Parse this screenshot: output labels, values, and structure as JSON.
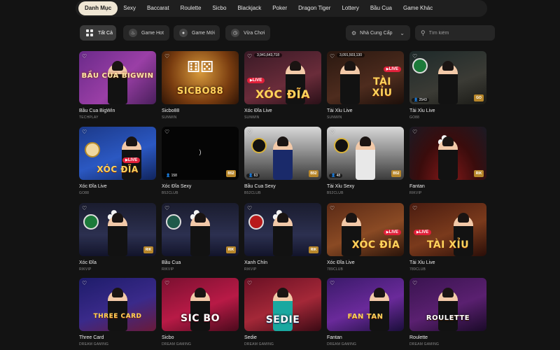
{
  "categories": {
    "active": "Danh Mục",
    "items": [
      "Sexy",
      "Baccarat",
      "Roulette",
      "Sicbo",
      "Blackjack",
      "Poker",
      "Dragon Tiger",
      "Lottery",
      "Bầu Cua",
      "Game Khác"
    ]
  },
  "filters": {
    "all": "Tất Cả",
    "hot": "Game Hot",
    "new": "Game Mới",
    "recent": "Vừa Chơi",
    "provider_label": "Nhà Cung Cấp",
    "search_placeholder": "Tìm kiếm"
  },
  "games": [
    {
      "title": "Bầu Cua BigWin",
      "provider": "TECHPLAY",
      "logo": "BẦU CUA BIGWIN"
    },
    {
      "title": "Sicbo88",
      "provider": "SUNWIN",
      "logo": "SICBO88"
    },
    {
      "title": "Xóc Đĩa Live",
      "provider": "SUNWIN",
      "logo": "XÓC ĐĨA",
      "live": "LIVE",
      "amount": "3,941,643,718"
    },
    {
      "title": "Tài Xỉu Live",
      "provider": "SUNWIN",
      "logo": "TÀI XỈU",
      "live": "LIVE",
      "amount": "3,091,503,130"
    },
    {
      "title": "Tài Xỉu Live",
      "provider": "GO88",
      "players": "2543"
    },
    {
      "title": "Xóc Đĩa Live",
      "provider": "GO88",
      "logo": "XÓC ĐĨA",
      "live": "LIVE"
    },
    {
      "title": "Xóc Đĩa Sexy",
      "provider": "B52CLUB",
      "players": "158",
      "center": ")"
    },
    {
      "title": "Bầu Cua Sexy",
      "provider": "B52CLUB",
      "players": "63"
    },
    {
      "title": "Tài Xỉu Sexy",
      "provider": "B52CLUB",
      "players": "48"
    },
    {
      "title": "Fantan",
      "provider": "RIKVIP"
    },
    {
      "title": "Xóc Đĩa",
      "provider": "RIKVIP"
    },
    {
      "title": "Bầu Cua",
      "provider": "RIKVIP"
    },
    {
      "title": "Xanh Chín",
      "provider": "RIKVIP"
    },
    {
      "title": "Xóc Đĩa Live",
      "provider": "789CLUB",
      "logo": "XÓC ĐĨA",
      "live": "LIVE"
    },
    {
      "title": "Tài Xỉu Live",
      "provider": "789CLUB",
      "logo": "TÀI XỈU",
      "live": "LIVE"
    },
    {
      "title": "Three Card",
      "provider": "DREAM GAMING",
      "logo": "THREE CARD"
    },
    {
      "title": "Sicbo",
      "provider": "DREAM GAMING",
      "logo": "SIC BO"
    },
    {
      "title": "Sedie",
      "provider": "DREAM GAMING",
      "logo": "SEDIE"
    },
    {
      "title": "Fantan",
      "provider": "DREAM GAMING",
      "logo": "FAN TAN"
    },
    {
      "title": "Roulette",
      "provider": "DREAM GAMING",
      "logo": "ROULETTE"
    }
  ],
  "colors": {
    "accent": "#efe6d4",
    "live": "#e0203a",
    "background": "#131313"
  }
}
